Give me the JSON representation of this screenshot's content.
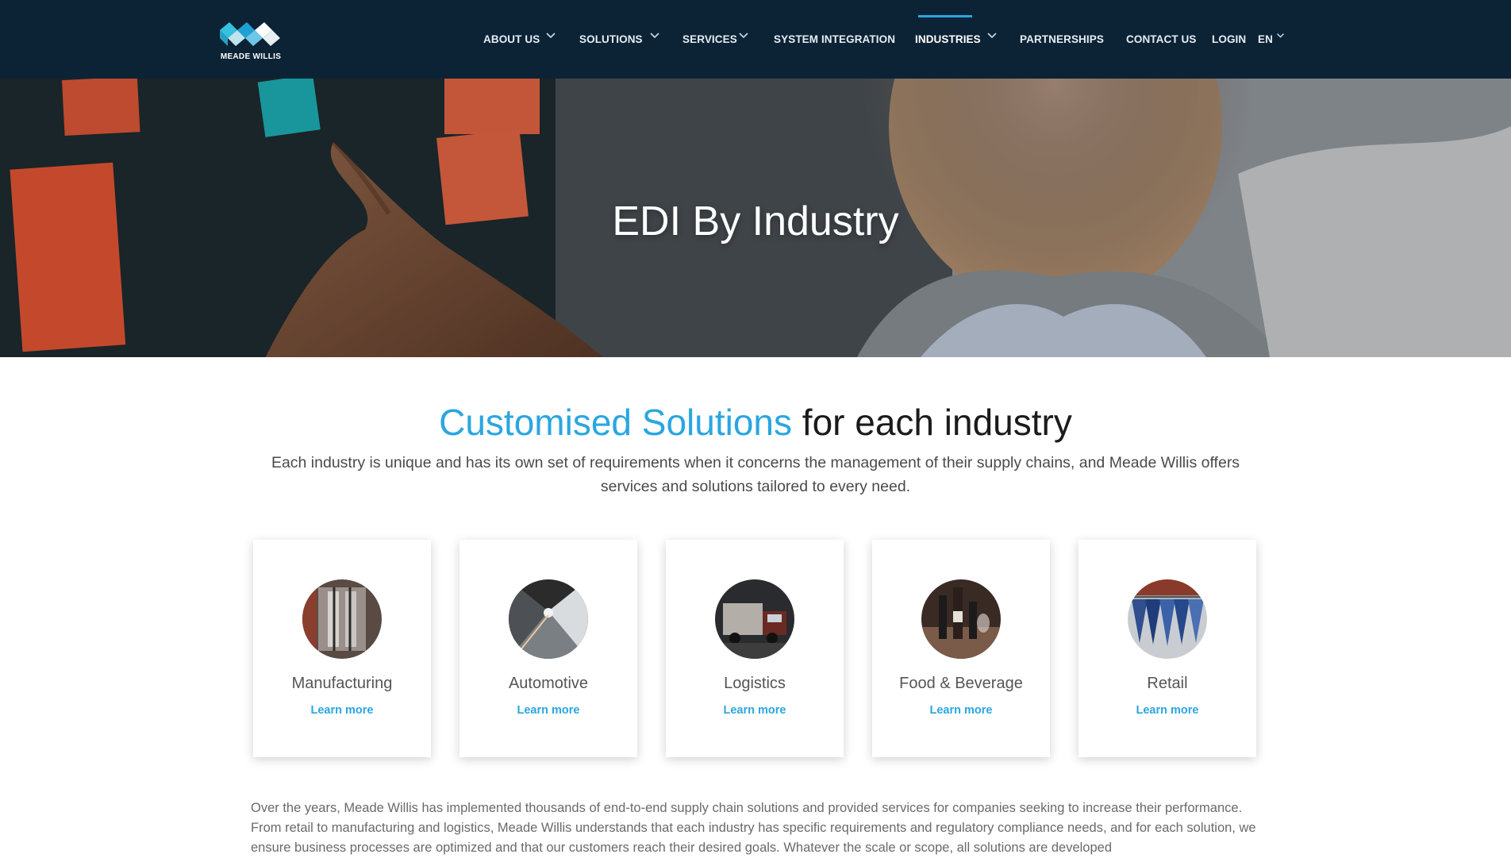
{
  "brand": {
    "logo_text": "MEADE WILLIS"
  },
  "nav": {
    "items": [
      {
        "label": "ABOUT US",
        "dropdown": true
      },
      {
        "label": "SOLUTIONS",
        "dropdown": true
      },
      {
        "label": "SERVICES",
        "dropdown": true
      },
      {
        "label": "SYSTEM INTEGRATION",
        "dropdown": false
      },
      {
        "label": "INDUSTRIES",
        "dropdown": true,
        "active": true
      },
      {
        "label": "PARTNERSHIPS",
        "dropdown": false
      },
      {
        "label": "CONTACT US",
        "dropdown": false
      },
      {
        "label": "LOGIN",
        "dropdown": false
      },
      {
        "label": "EN",
        "dropdown": true
      }
    ]
  },
  "hero": {
    "title": "EDI By Industry"
  },
  "section": {
    "title_accent": "Customised Solutions",
    "title_rest": " for each industry",
    "subtitle": "Each industry is unique and has its own set of requirements when it concerns the management of their supply chains, and Meade Willis offers services and solutions tailored to every need."
  },
  "cards": [
    {
      "name": "Manufacturing",
      "link": "Learn more",
      "image": "manufacturing-machinery"
    },
    {
      "name": "Automotive",
      "link": "Learn more",
      "image": "automotive-tunnel"
    },
    {
      "name": "Logistics",
      "link": "Learn more",
      "image": "logistics-truck"
    },
    {
      "name": "Food & Beverage",
      "link": "Learn more",
      "image": "food-beverage-bottles"
    },
    {
      "name": "Retail",
      "link": "Learn more",
      "image": "retail-clothing-rack"
    }
  ],
  "body_text": "Over the years, Meade Willis has implemented thousands of end-to-end supply chain solutions and provided services for companies seeking to increase their performance. From retail to manufacturing and logistics, Meade Willis understands that each industry has specific requirements and regulatory compliance needs, and for each solution, we ensure business processes are optimized and that our customers reach their desired goals. Whatever the scale or scope, all solutions are developed",
  "colors": {
    "header_bg": "#0c2336",
    "accent": "#2aa6e0"
  }
}
